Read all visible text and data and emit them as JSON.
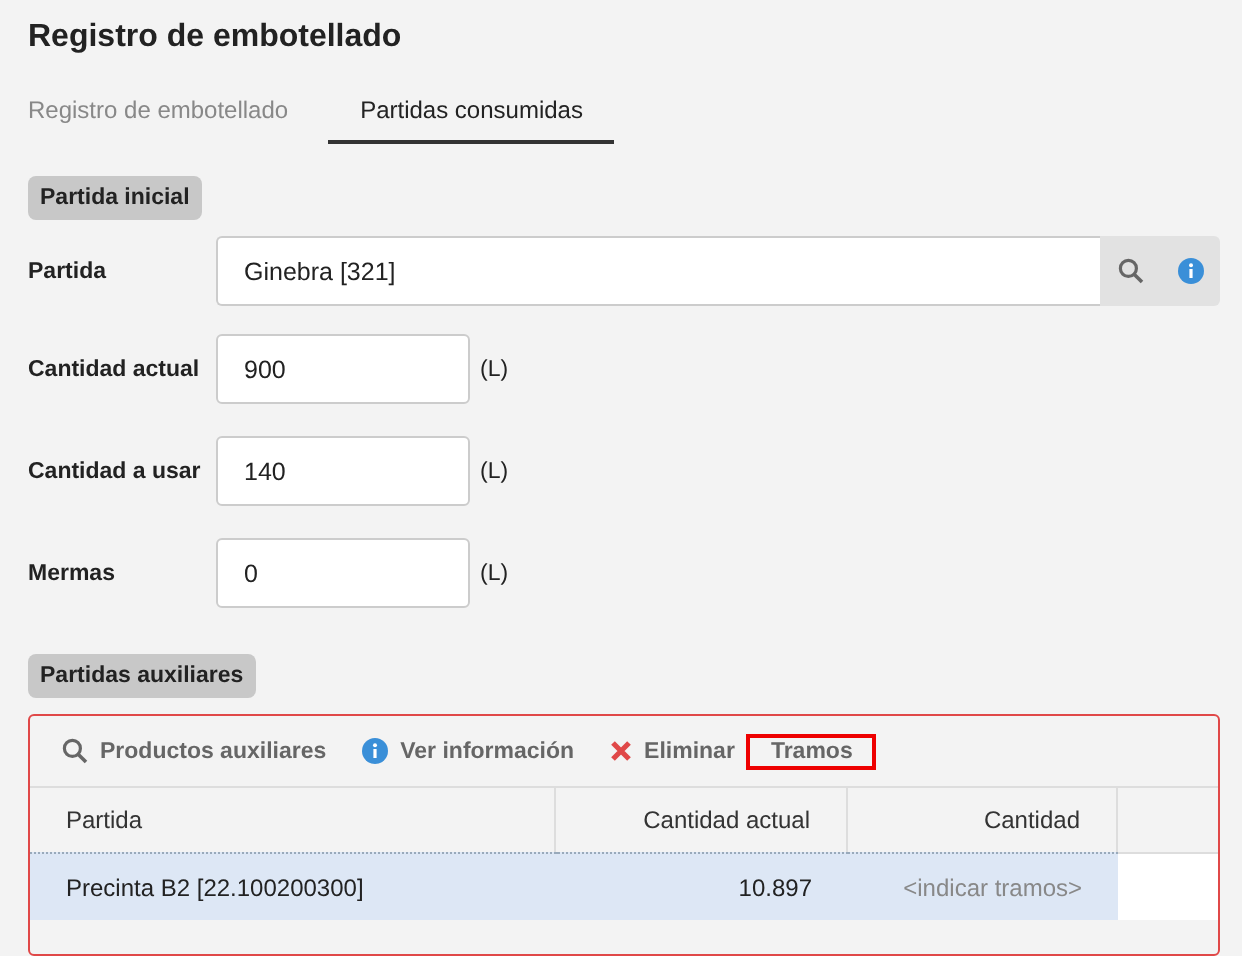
{
  "title": "Registro de embotellado",
  "tabs": [
    {
      "label": "Registro de embotellado",
      "selected": false
    },
    {
      "label": "Partidas consumidas",
      "selected": true
    }
  ],
  "initial_section": {
    "heading": "Partida inicial",
    "fields": [
      {
        "kind": "lookup",
        "label": "Partida",
        "value": "Ginebra [321]"
      },
      {
        "kind": "quantity",
        "label": "Cantidad actual",
        "value": "900",
        "unit": "(L)"
      },
      {
        "kind": "quantity",
        "label": "Cantidad a usar",
        "value": "140",
        "unit": "(L)"
      },
      {
        "kind": "quantity",
        "label": "Mermas",
        "value": "0",
        "unit": "(L)"
      }
    ]
  },
  "aux_section": {
    "heading": "Partidas auxiliares",
    "toolbar": [
      {
        "kind": "search",
        "label": "Productos auxiliares",
        "highlighted": false
      },
      {
        "kind": "info",
        "label": "Ver información",
        "highlighted": false
      },
      {
        "kind": "delete",
        "label": "Eliminar",
        "highlighted": false
      },
      {
        "kind": "plain",
        "label": "Tramos",
        "highlighted": true
      }
    ],
    "table": {
      "columns": [
        "Partida",
        "Cantidad actual",
        "Cantidad"
      ],
      "rows": [
        {
          "selected": true,
          "cells": [
            {
              "kind": "text",
              "text": "Precinta B2 [22.100200300]"
            },
            {
              "kind": "text",
              "text": "10.897"
            },
            {
              "kind": "hint",
              "text": "<indicar tramos>"
            }
          ]
        }
      ]
    }
  }
}
